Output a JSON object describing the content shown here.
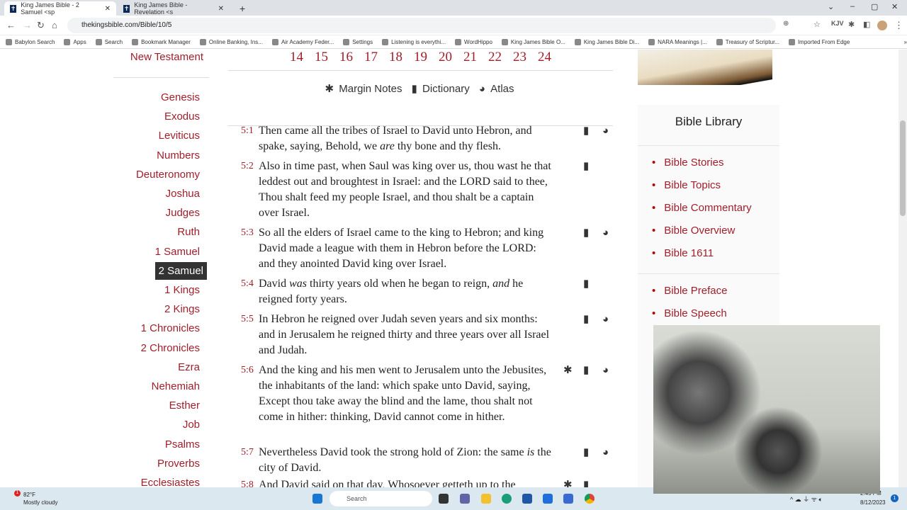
{
  "browser": {
    "tabs": [
      {
        "title": "King James Bible - 2 Samuel <sp",
        "active": true
      },
      {
        "title": "King James Bible - Revelation <s",
        "active": false
      }
    ],
    "new_tab": "+",
    "url": "thekingsbible.com/Bible/10/5",
    "bookmarks": [
      "Babylon Search",
      "Apps",
      "Search",
      "Bookmark Manager",
      "Online Banking, Ins...",
      "Air Academy Feder...",
      "Settings",
      "Listening is everythi...",
      "WordHippo",
      "King James Bible O...",
      "King James Bible Di...",
      "NARA Meanings |...",
      "Treasury of Scriptur...",
      "Imported From Edge"
    ],
    "more": "»",
    "ext_label": "KJV"
  },
  "sidebar": {
    "testament": "New Testament",
    "selected": "2 Samuel",
    "books": [
      "Genesis",
      "Exodus",
      "Leviticus",
      "Numbers",
      "Deuteronomy",
      "Joshua",
      "Judges",
      "Ruth",
      "1 Samuel",
      "2 Samuel",
      "1 Kings",
      "2 Kings",
      "1 Chronicles",
      "2 Chronicles",
      "Ezra",
      "Nehemiah",
      "Esther",
      "Job",
      "Psalms",
      "Proverbs",
      "Ecclesiastes"
    ]
  },
  "chapters": [
    "14",
    "15",
    "16",
    "17",
    "18",
    "19",
    "20",
    "21",
    "22",
    "23",
    "24"
  ],
  "tools": {
    "margin_notes": "Margin Notes",
    "dictionary": "Dictionary",
    "atlas": "Atlas"
  },
  "verses": [
    {
      "ref": "5:1",
      "parts": [
        {
          "t": "Then came all the tribes of Israel to David unto Hebron, and spake, saying, Behold, we "
        },
        {
          "t": "are",
          "i": true
        },
        {
          "t": " thy bone and thy flesh."
        }
      ],
      "icons": [
        "book",
        "globe"
      ]
    },
    {
      "ref": "5:2",
      "parts": [
        {
          "t": "Also in time past, when Saul was king over us, thou wast he that leddest out and broughtest in Israel: and the LORD said to thee, Thou shalt feed my people Israel, and thou shalt be a captain over Israel."
        }
      ],
      "icons": [
        "book"
      ]
    },
    {
      "ref": "5:3",
      "parts": [
        {
          "t": "So all the elders of Israel came to the king to Hebron; and king David made a league with them in Hebron before the LORD: and they anointed David king over Israel."
        }
      ],
      "icons": [
        "book",
        "globe"
      ]
    },
    {
      "ref": "5:4",
      "parts": [
        {
          "t": "David "
        },
        {
          "t": "was",
          "i": true
        },
        {
          "t": " thirty years old when he began to reign, "
        },
        {
          "t": "and",
          "i": true
        },
        {
          "t": " he reigned forty years."
        }
      ],
      "icons": [
        "book"
      ]
    },
    {
      "ref": "5:5",
      "parts": [
        {
          "t": "In Hebron he reigned over Judah seven years and six months: and in Jerusalem he reigned thirty and three years over all Israel and Judah."
        }
      ],
      "icons": [
        "book",
        "globe"
      ]
    },
    {
      "ref": "5:6",
      "parts": [
        {
          "t": "And the king and his men went to Jerusalem unto the Jebusites, the inhabitants of the land: which spake unto David, saying, Except thou take away the blind and the lame, thou shalt not come in hither: thinking, David cannot come in hither."
        }
      ],
      "icons": [
        "note",
        "book",
        "globe"
      ]
    },
    {
      "ref": "5:7",
      "parts": [
        {
          "t": "Nevertheless David took the strong hold of Zion: the same "
        },
        {
          "t": "is",
          "i": true
        },
        {
          "t": " the city of David."
        }
      ],
      "icons": [
        "book",
        "globe"
      ]
    },
    {
      "ref": "5:8",
      "parts": [
        {
          "t": "And David said on that day, Whosoever getteth up to the"
        }
      ],
      "icons": [
        "note",
        "book"
      ]
    }
  ],
  "library": {
    "title": "Bible Library",
    "items": [
      "Bible Stories",
      "Bible Topics",
      "Bible Commentary",
      "Bible Overview",
      "Bible 1611"
    ],
    "items2": [
      "Bible Preface",
      "Bible Speech"
    ]
  },
  "taskbar": {
    "temp": "82°F",
    "weather": "Mostly cloudy",
    "search": "Search",
    "time": "2:45 PM",
    "date": "8/12/2023",
    "badge": "1"
  },
  "colors": {
    "accent": "#a11e2b",
    "selected_bg": "#333333"
  }
}
